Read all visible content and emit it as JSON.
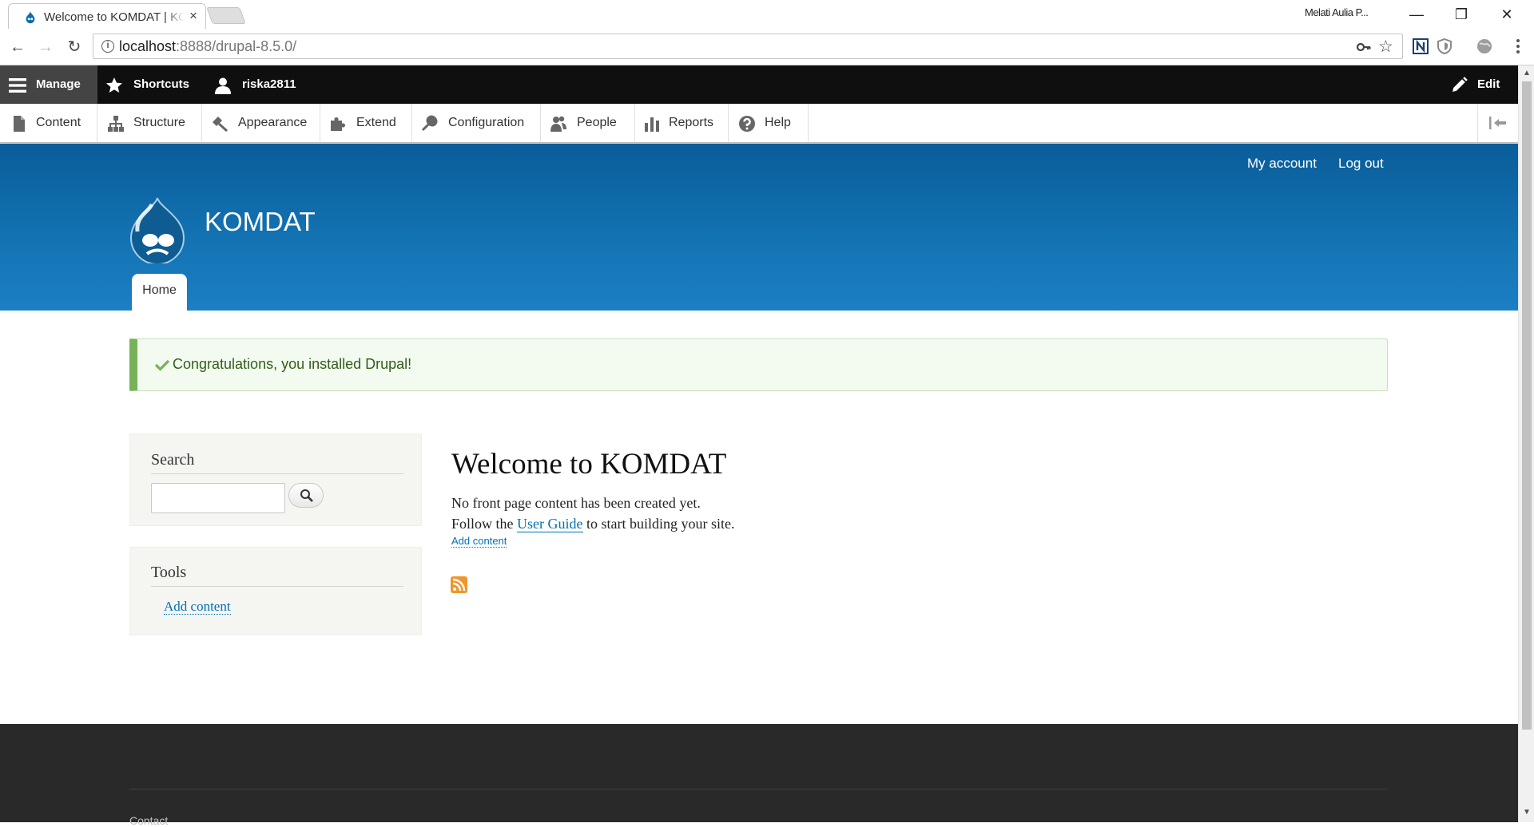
{
  "browser": {
    "tab_title": "Welcome to KOMDAT | KOMDAT",
    "tab_close": "×",
    "profile_name": "Melati Aulia P...",
    "window_controls": {
      "minimize": "—",
      "restore": "❐",
      "close": "✕"
    },
    "nav": {
      "back": "←",
      "forward": "→",
      "reload": "↻"
    },
    "url_host": "localhost",
    "url_rest": ":8888/drupal-8.5.0/",
    "info_icon": "i",
    "key_icon": "key-icon",
    "star_icon": "☆"
  },
  "toolbar": {
    "manage": "Manage",
    "shortcuts": "Shortcuts",
    "user": "riska2811",
    "edit": "Edit"
  },
  "tray": {
    "items": [
      {
        "label": "Content",
        "icon": "file-icon"
      },
      {
        "label": "Structure",
        "icon": "sitemap-icon"
      },
      {
        "label": "Appearance",
        "icon": "paint-icon"
      },
      {
        "label": "Extend",
        "icon": "puzzle-icon"
      },
      {
        "label": "Configuration",
        "icon": "wrench-icon"
      },
      {
        "label": "People",
        "icon": "people-icon"
      },
      {
        "label": "Reports",
        "icon": "bar-chart-icon"
      },
      {
        "label": "Help",
        "icon": "help-icon"
      }
    ]
  },
  "header": {
    "my_account": "My account",
    "log_out": "Log out",
    "site_name": "KOMDAT",
    "home_tab": "Home"
  },
  "messages": {
    "status": "Congratulations, you installed Drupal!"
  },
  "sidebar": {
    "search_title": "Search",
    "tools_title": "Tools",
    "tools_link": "Add content"
  },
  "main": {
    "title": "Welcome to KOMDAT",
    "line1": "No front page content has been created yet.",
    "line2_before": "Follow the ",
    "line2_link": "User Guide",
    "line2_after": " to start building your site.",
    "add_content": "Add content"
  },
  "footer": {
    "text": "Contact"
  },
  "colors": {
    "toolbar": "#0f0f0f",
    "header_blue": "#1372b2",
    "link": "#0071b3",
    "status_green": "#77b259",
    "footer": "#292929"
  }
}
